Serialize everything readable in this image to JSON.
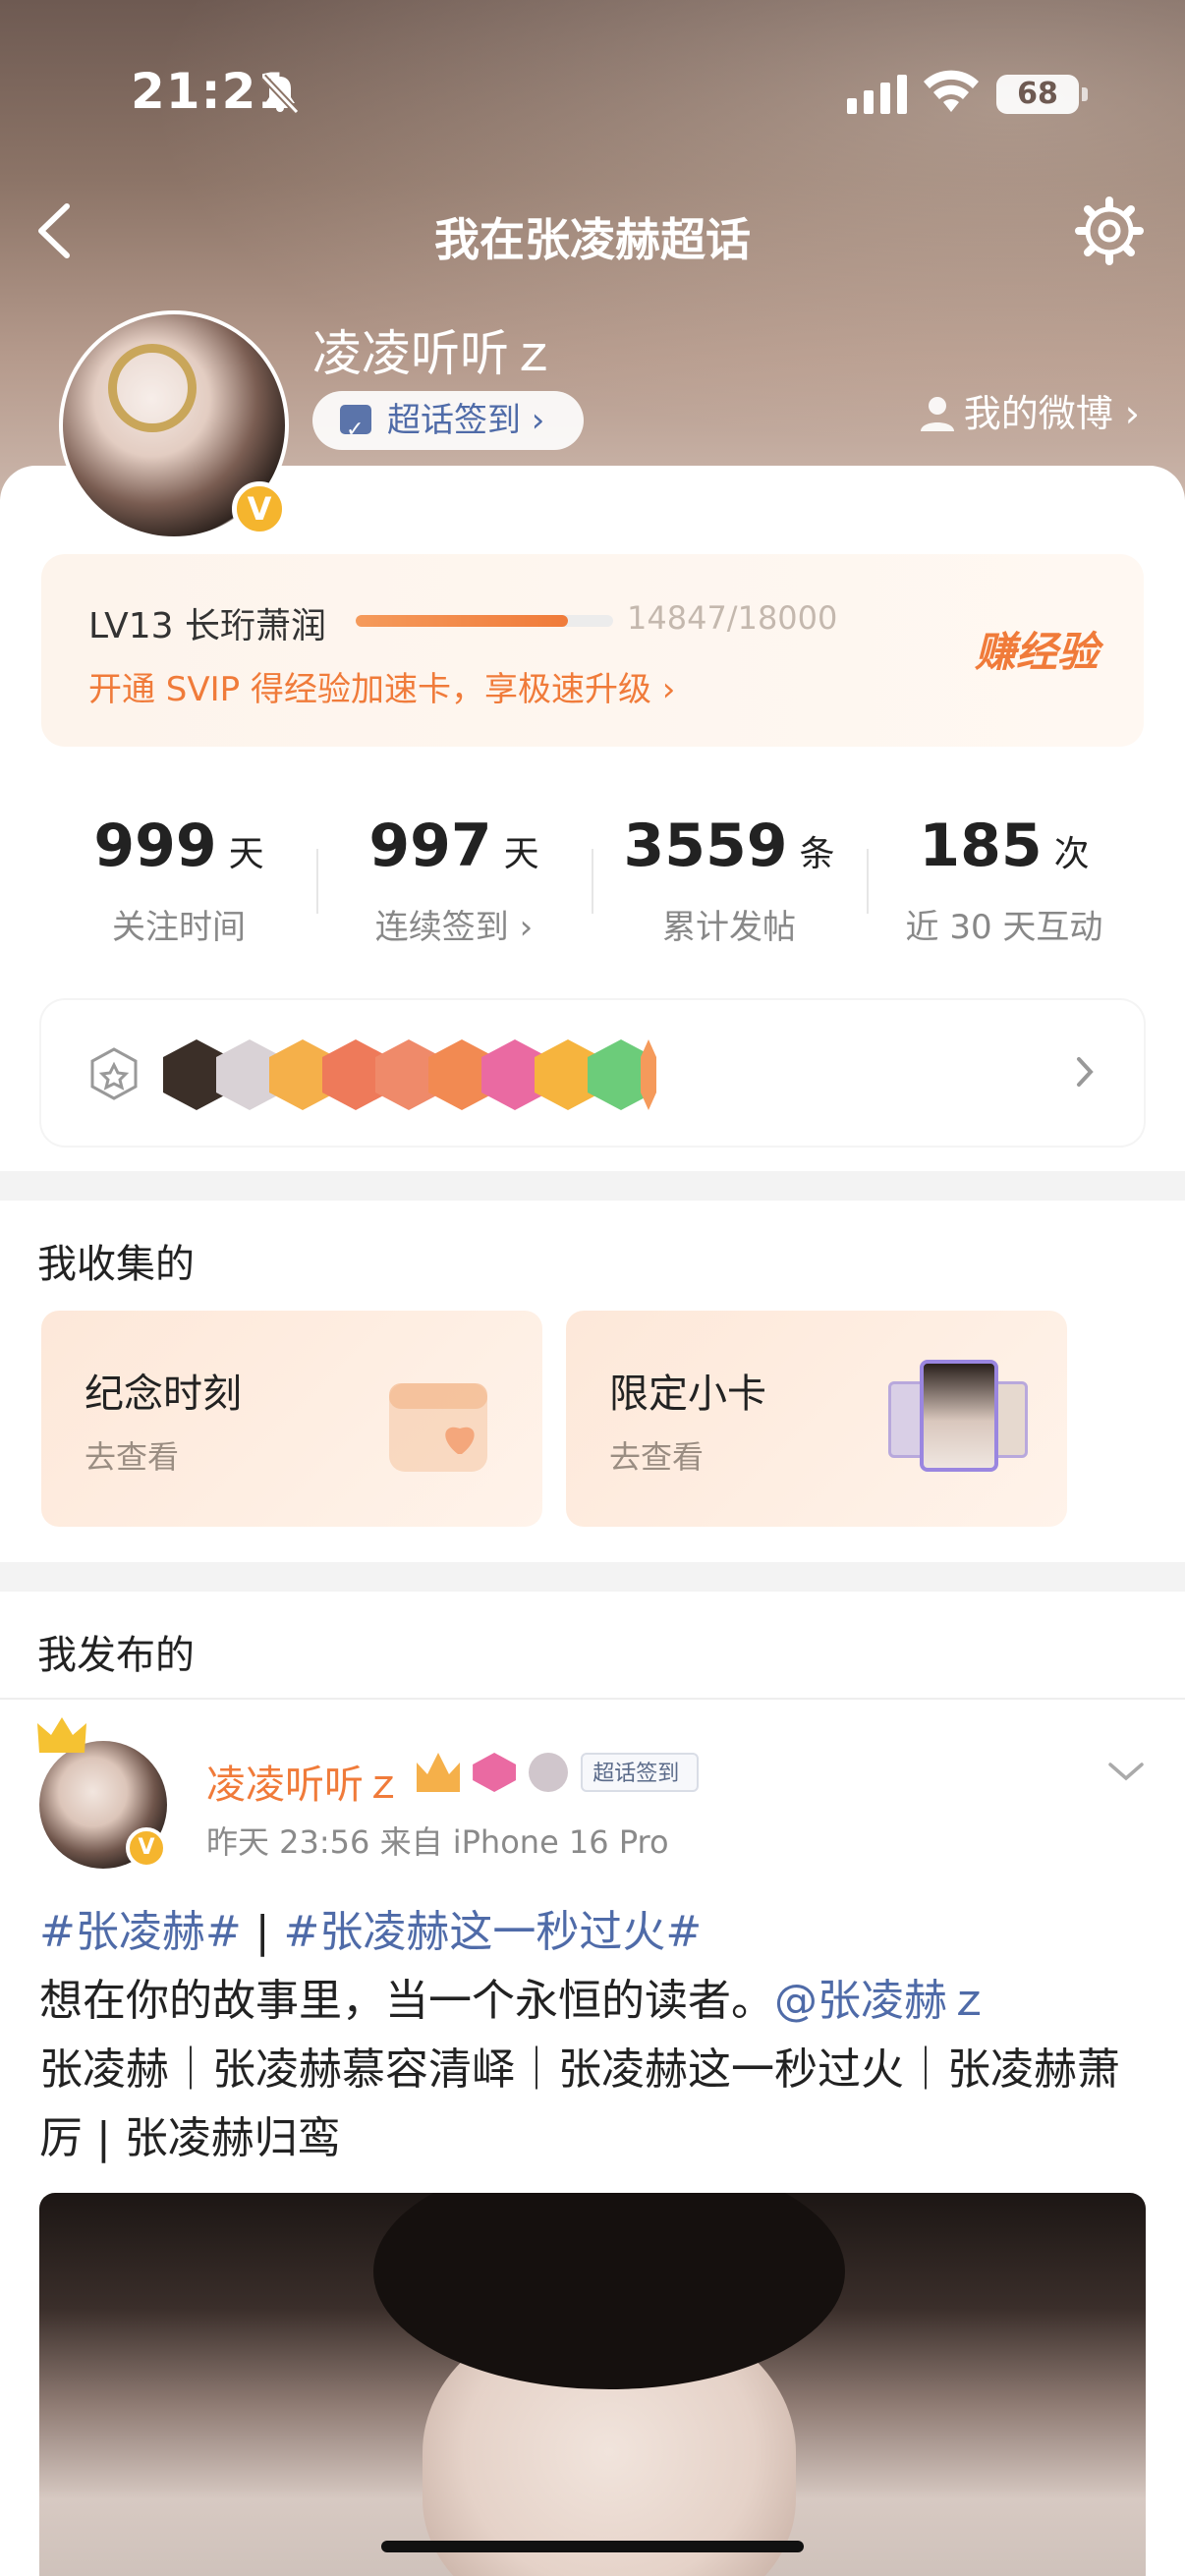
{
  "status_bar": {
    "time": "21:21",
    "battery": "68"
  },
  "nav": {
    "title": "我在张凌赫超话"
  },
  "profile": {
    "username": "凌凌听听ｚ",
    "checkin_label": "超话签到 ›",
    "my_weibo_label": "我的微博 ›",
    "verified_mark": "V"
  },
  "level": {
    "title": "LV13 长珩萧润",
    "progress_text": "14847/18000",
    "progress_fraction": 0.8248,
    "promo": "开通 SVIP 得经验加速卡，享极速升级 ›",
    "earn_label": "赚经验"
  },
  "stats": [
    {
      "value": "999",
      "unit": "天",
      "label": "关注时间"
    },
    {
      "value": "997",
      "unit": "天",
      "label": "连续签到 ›"
    },
    {
      "value": "3559",
      "unit": "条",
      "label": "累计发帖"
    },
    {
      "value": "185",
      "unit": "次",
      "label": "近 30 天互动"
    }
  ],
  "medals": {
    "items": [
      {
        "name": "super-medal-icon",
        "color": "#3b2f28"
      },
      {
        "name": "anime-medal-icon",
        "color": "#d9d2d6"
      },
      {
        "name": "crown-medal-icon",
        "color": "#f5b04a"
      },
      {
        "name": "cat-medal-icon",
        "color": "#ee7a5a"
      },
      {
        "name": "cat-medal-2-icon",
        "color": "#ef8a6a"
      },
      {
        "name": "fox-medal-icon",
        "color": "#f28a52"
      },
      {
        "name": "lv13-medal-icon",
        "color": "#ea6aa2"
      },
      {
        "name": "hi-medal-icon",
        "color": "#f6b43e"
      },
      {
        "name": "hand-medal-icon",
        "color": "#6ccc7a"
      },
      {
        "name": "partial-medal-icon",
        "color": "#f59a5b"
      }
    ]
  },
  "collected": {
    "title": "我收集的",
    "cards": [
      {
        "title": "纪念时刻",
        "sub": "去查看"
      },
      {
        "title": "限定小卡",
        "sub": "去查看"
      }
    ]
  },
  "published": {
    "title": "我发布的",
    "post": {
      "author": "凌凌听听ｚ",
      "checkin_badge": "超话签到",
      "meta": "昨天 23:56  来自 iPhone 16 Pro",
      "tag1": "#张凌赫#",
      "sep": " | ",
      "tag2": "#张凌赫这一秒过火#",
      "line2_text": "想在你的故事里，当一个永恒的读者。",
      "mention": "@张凌赫ｚ",
      "line3": "张凌赫｜张凌赫慕容清峄｜张凌赫这一秒过火｜张凌赫萧厉 | 张凌赫归鸾"
    }
  }
}
